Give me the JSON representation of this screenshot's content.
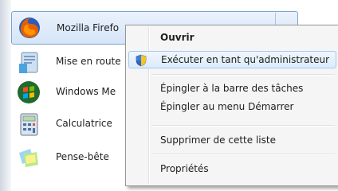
{
  "start_menu": {
    "pinned": [
      {
        "label": "Mozilla Firefo",
        "icon": "firefox-icon"
      },
      {
        "label": "Mise en route",
        "icon": "getting-started-icon"
      },
      {
        "label": "Windows Me",
        "icon": "windows-media-center-icon"
      },
      {
        "label": "Calculatrice",
        "icon": "calculator-icon"
      },
      {
        "label": "Pense-bête",
        "icon": "sticky-notes-icon"
      }
    ],
    "jumplist_arrow": "▸"
  },
  "context_menu": {
    "items": [
      {
        "label": "Ouvrir"
      },
      {
        "label": "Exécuter en tant qu'administrateur",
        "icon": "uac-shield-icon"
      },
      {
        "label": "Épingler à la barre des tâches"
      },
      {
        "label": "Épingler au menu Démarrer"
      },
      {
        "label": "Supprimer de cette liste"
      },
      {
        "label": "Propriétés"
      }
    ]
  },
  "colors": {
    "highlight_border": "#a8c8ea",
    "selected_item_border": "#7da2ce",
    "menu_background": "#f5f5f5"
  }
}
